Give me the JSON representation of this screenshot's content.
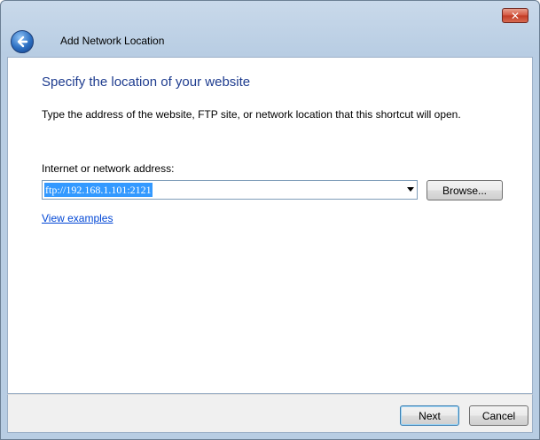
{
  "window": {
    "title": "Add Network Location",
    "close_symbol": "✕"
  },
  "page": {
    "heading": "Specify the location of your website",
    "description": "Type the address of the website, FTP site, or network location that this shortcut will open.",
    "address_label": "Internet or network address:",
    "address_value": "ftp://192.168.1.101:2121",
    "browse_label": "Browse...",
    "view_examples_label": "View examples"
  },
  "footer": {
    "next_label": "Next",
    "cancel_label": "Cancel"
  },
  "colors": {
    "heading": "#1e3c8f",
    "link": "#0046d5",
    "selection": "#3399ff"
  },
  "icons": {
    "back": "back-arrow-icon",
    "close": "close-icon",
    "dropdown": "chevron-down-icon"
  }
}
